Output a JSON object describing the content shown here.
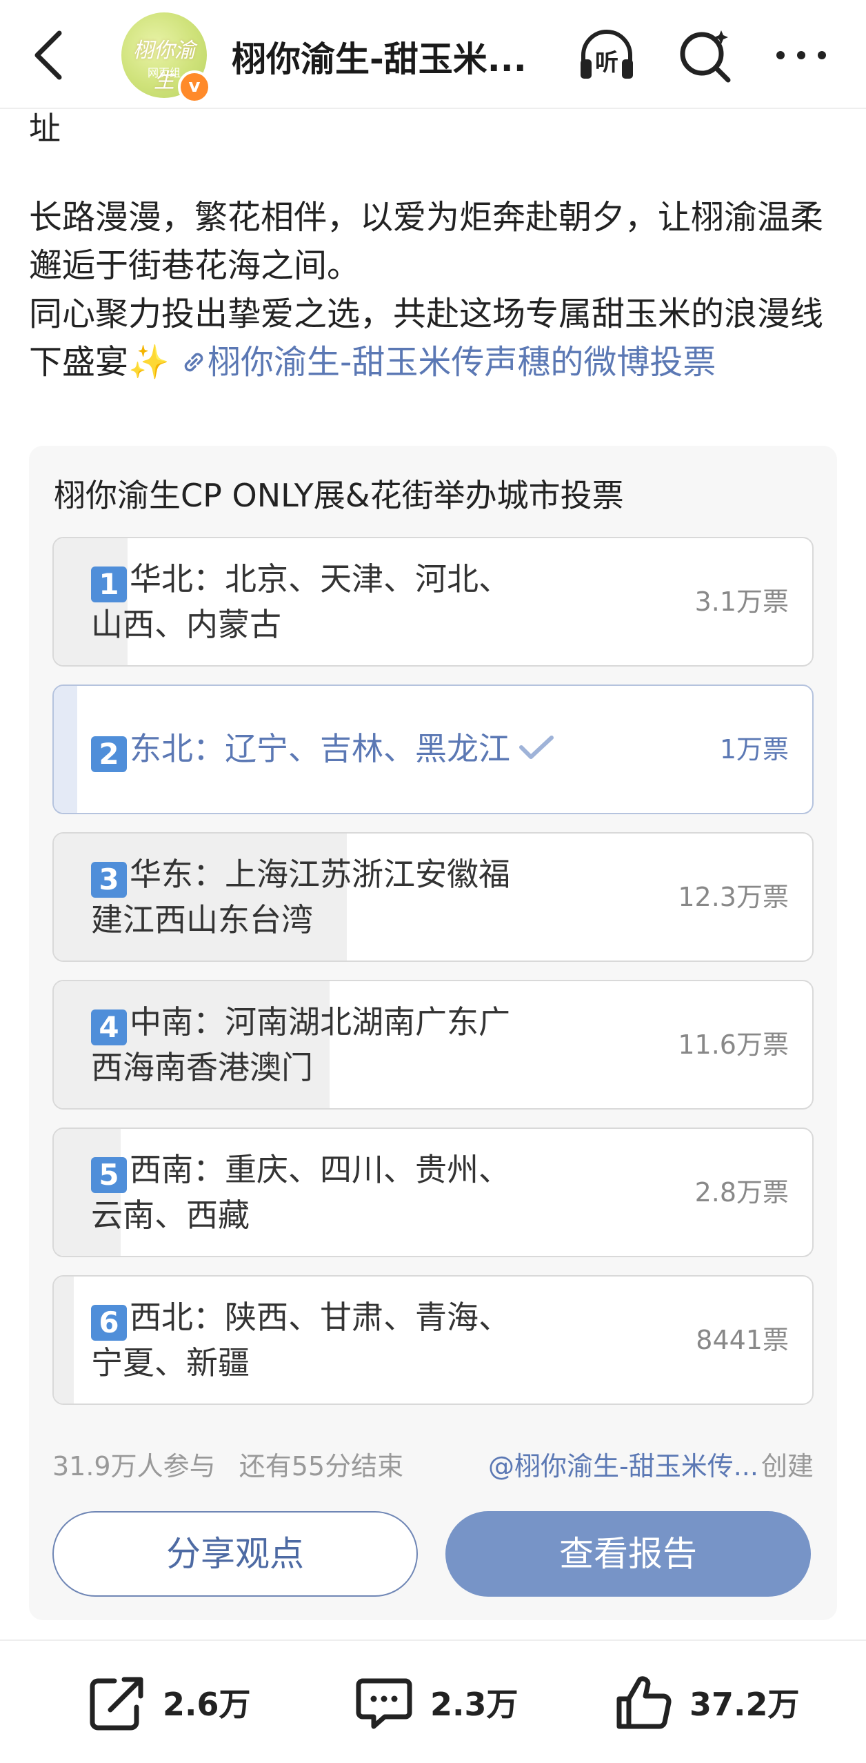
{
  "header": {
    "title": "栩你渝生-甜玉米...",
    "avatar_text": "栩你渝生",
    "avatar_sub": "网页组",
    "verified_mark": "v",
    "listen_label": "听"
  },
  "post": {
    "top_fragment": "址",
    "paragraph1": "长路漫漫，繁花相伴，以爱为炬奔赴朝夕，让栩渝温柔邂逅于街巷花海之间。",
    "paragraph2": "同心聚力投出挚爱之选，共赴这场专属甜玉米的浪漫线下盛宴",
    "emoji": "✨",
    "link_text": "栩你渝生-甜玉米传声穗的微博投票"
  },
  "poll": {
    "title": "栩你渝生CP ONLY展&花街举办城市投票",
    "options": [
      {
        "num": "1",
        "line1": "华北：北京、天津、河北、",
        "line2": "山西、内蒙古",
        "votes": "3.1万票",
        "share": 0.097,
        "selected": false
      },
      {
        "num": "2",
        "line1": "东北：辽宁、吉林、黑龙江",
        "line2": "",
        "votes": "1万票",
        "share": 0.031,
        "selected": true
      },
      {
        "num": "3",
        "line1": "华东：上海江苏浙江安徽福",
        "line2": "建江西山东台湾",
        "votes": "12.3万票",
        "share": 0.386,
        "selected": false
      },
      {
        "num": "4",
        "line1": "中南：河南湖北湖南广东广",
        "line2": "西海南香港澳门",
        "votes": "11.6万票",
        "share": 0.364,
        "selected": false
      },
      {
        "num": "5",
        "line1": "西南：重庆、四川、贵州、",
        "line2": "云南、西藏",
        "votes": "2.8万票",
        "share": 0.088,
        "selected": false
      },
      {
        "num": "6",
        "line1": "西北：陕西、甘肃、青海、",
        "line2": "宁夏、新疆",
        "votes": "8441票",
        "share": 0.026,
        "selected": false
      }
    ],
    "participants": "31.9万人参与",
    "remaining": "还有55分结束",
    "creator": "@栩你渝生-甜玉米传...",
    "created_label": "创建",
    "share_button": "分享观点",
    "report_button": "查看报告",
    "accent_color": "#5b78b4"
  },
  "actions": {
    "repost_count": "2.6万",
    "comment_count": "2.3万",
    "like_count": "37.2万"
  }
}
